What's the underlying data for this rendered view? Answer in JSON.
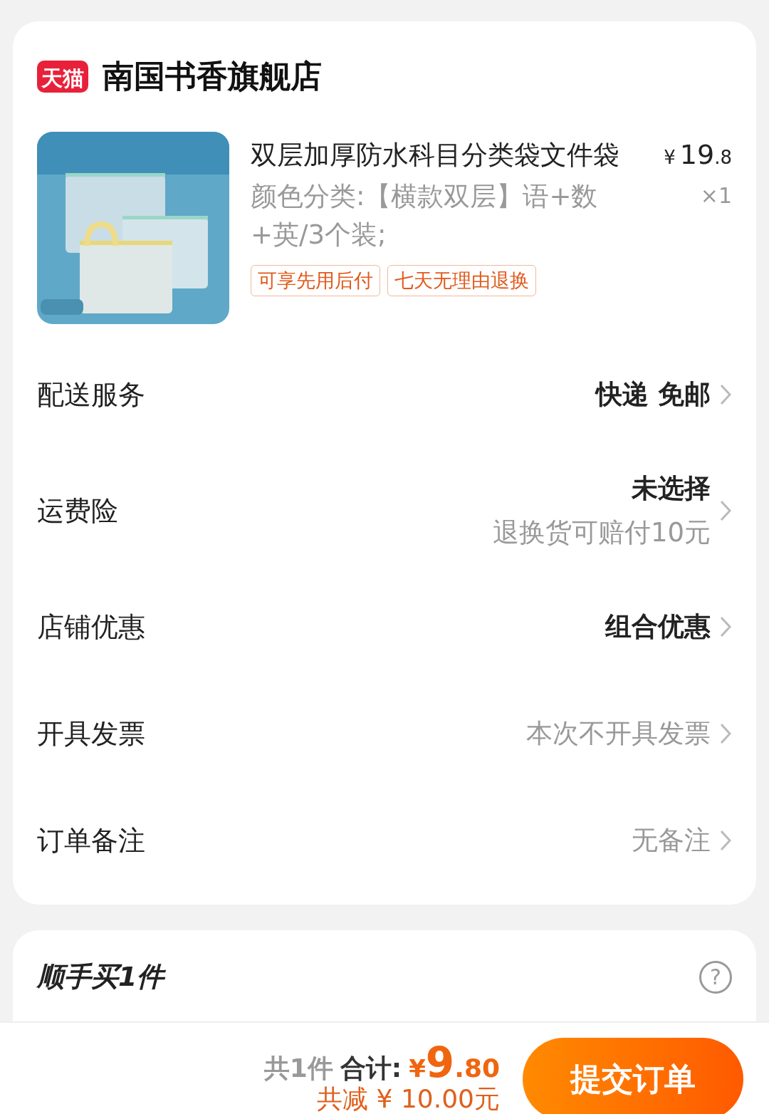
{
  "store": {
    "badge": "天猫",
    "name": "南国书香旗舰店"
  },
  "product": {
    "kind": "picture",
    "title": "双层加厚防水科目分类袋文件袋",
    "currency": "¥",
    "price_int": "19",
    "price_dec": ".8",
    "spec": "颜色分类:【横款双层】语+数+英/3个装;",
    "quantity": "×1",
    "tags": [
      "可享先用后付",
      "七天无理由退换"
    ]
  },
  "rows": [
    {
      "label": "配送服务",
      "kind": "bold",
      "value": "快递 免邮"
    },
    {
      "label": "运费险",
      "kind": "bold",
      "value": "未选择",
      "sub": "退换货可赔付10元"
    },
    {
      "label": "店铺优惠",
      "kind": "bold",
      "value": "组合优惠"
    },
    {
      "label": "开具发票",
      "kind": "muted",
      "value": "本次不开具发票"
    },
    {
      "label": "订单备注",
      "kind": "muted",
      "value": "无备注"
    }
  ],
  "addon": {
    "title": "顺手买1件",
    "help": "?"
  },
  "footer": {
    "count": "共1件",
    "total_label": "合计:",
    "currency": "¥",
    "total_int": "9",
    "total_dec": ".80",
    "saving": "共减 ¥ 10.00元",
    "submit": "提交订单"
  }
}
